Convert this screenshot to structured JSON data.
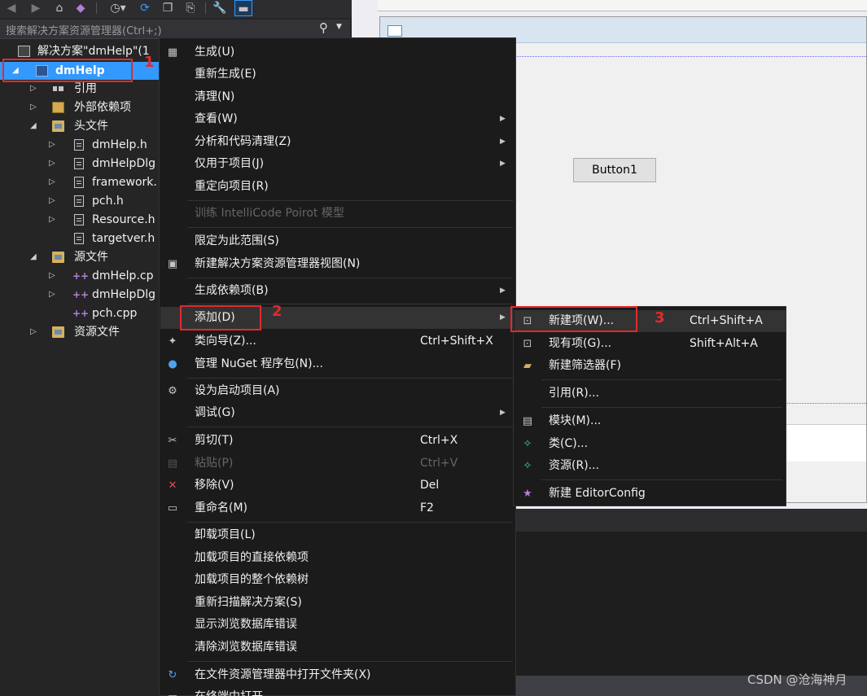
{
  "explorer": {
    "search_placeholder": "搜索解决方案资源管理器(Ctrl+;)",
    "solution_label": "解决方案\"dmHelp\"(1",
    "project_label": "dmHelp",
    "tree": {
      "ref": "引用",
      "external": "外部依赖项",
      "headers": "头文件",
      "h1": "dmHelp.h",
      "h2": "dmHelpDlg",
      "h3": "framework.",
      "h4": "pch.h",
      "h5": "Resource.h",
      "h6": "targetver.h",
      "sources": "源文件",
      "s1": "dmHelp.cp",
      "s2": "dmHelpDlg",
      "s3": "pch.cpp",
      "resources": "资源文件"
    }
  },
  "annotations": {
    "n1": "1",
    "n2": "2",
    "n3": "3"
  },
  "designer": {
    "button_label": "Button1"
  },
  "menu": {
    "build": "生成(U)",
    "rebuild": "重新生成(E)",
    "clean": "清理(N)",
    "view": "查看(W)",
    "analyze": "分析和代码清理(Z)",
    "project_only": "仅用于项目(J)",
    "retarget": "重定向项目(R)",
    "intellicode": "训练 IntelliCode Poirot 模型",
    "scope": "限定为此范围(S)",
    "new_view": "新建解决方案资源管理器视图(N)",
    "build_deps": "生成依赖项(B)",
    "add": "添加(D)",
    "class_wizard": "类向导(Z)...",
    "class_wizard_shortcut": "Ctrl+Shift+X",
    "nuget": "管理 NuGet 程序包(N)...",
    "startup": "设为启动项目(A)",
    "debug": "调试(G)",
    "cut": "剪切(T)",
    "cut_shortcut": "Ctrl+X",
    "paste": "粘贴(P)",
    "paste_shortcut": "Ctrl+V",
    "remove": "移除(V)",
    "remove_shortcut": "Del",
    "rename": "重命名(M)",
    "rename_shortcut": "F2",
    "unload": "卸载项目(L)",
    "load_direct": "加载项目的直接依赖项",
    "load_tree": "加载项目的整个依赖树",
    "rescan": "重新扫描解决方案(S)",
    "show_db_errors": "显示浏览数据库错误",
    "clear_db_errors": "清除浏览数据库错误",
    "open_folder": "在文件资源管理器中打开文件夹(X)",
    "open_terminal": "在终端中打开"
  },
  "submenu": {
    "new_item": "新建项(W)...",
    "new_item_shortcut": "Ctrl+Shift+A",
    "existing_item": "现有项(G)...",
    "existing_item_shortcut": "Shift+Alt+A",
    "new_filter": "新建筛选器(F)",
    "reference": "引用(R)...",
    "module": "模块(M)...",
    "class": "类(C)...",
    "resource": "资源(R)...",
    "editorconfig": "新建 EditorConfig"
  },
  "watermark": "CSDN @沧海神月"
}
